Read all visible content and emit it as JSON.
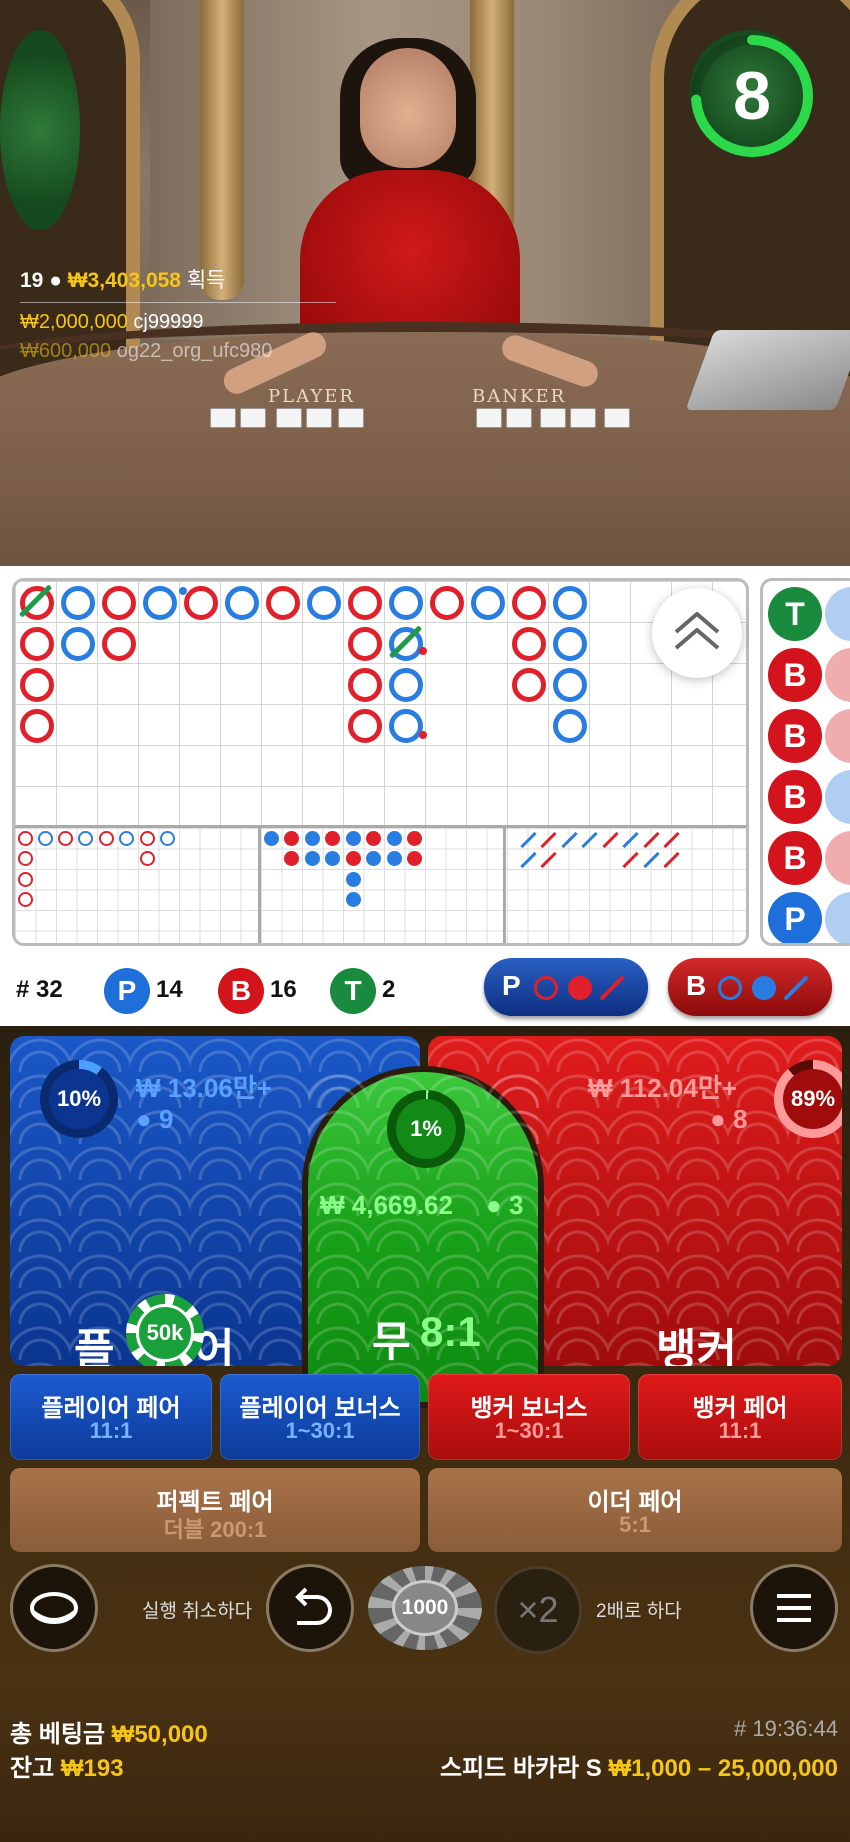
{
  "video": {
    "timer": "8",
    "table_labels": {
      "player": "PLAYER",
      "banker": "BANKER"
    },
    "winners": {
      "count": "19",
      "total": "₩3,403,058",
      "suffix": "획득",
      "rows": [
        {
          "amount": "₩2,000,000",
          "user": "cj99999"
        },
        {
          "amount": "₩600,000",
          "user": "og22_org_ufc980"
        }
      ]
    }
  },
  "stats": {
    "round_label": "# 32",
    "player": {
      "letter": "P",
      "count": "14"
    },
    "banker": {
      "letter": "B",
      "count": "16"
    },
    "tie": {
      "letter": "T",
      "count": "2"
    },
    "predict_player": "P",
    "predict_banker": "B"
  },
  "bead_road": [
    "T",
    "B",
    "B",
    "B",
    "B",
    "P"
  ],
  "bets": {
    "player": {
      "percent": "10%",
      "amount": "₩ 13.06만+",
      "players": "9",
      "label": "플레이어",
      "label_left": "플",
      "label_right": "어",
      "chip": "50k"
    },
    "tie": {
      "percent": "1%",
      "amount": "₩ 4,669.62",
      "players": "3",
      "label": "무",
      "odds": "8:1"
    },
    "banker": {
      "percent": "89%",
      "amount": "₩ 112.04만+",
      "players": "8",
      "label": "뱅커"
    }
  },
  "side_bets": [
    {
      "name": "플레이어 페어",
      "odds": "11:1"
    },
    {
      "name": "플레이어 보너스",
      "odds": "1~30:1"
    },
    {
      "name": "뱅커 보너스",
      "odds": "1~30:1"
    },
    {
      "name": "뱅커 페어",
      "odds": "11:1"
    }
  ],
  "pair_bets": [
    {
      "name": "퍼펙트 페어",
      "odds": "더블 200:1"
    },
    {
      "name": "이더 페어",
      "odds": "5:1"
    }
  ],
  "controls": {
    "undo_label": "실행 취소하다",
    "chip_value": "1000",
    "double_icon": "×2",
    "double_label": "2배로 하다"
  },
  "footer": {
    "total_bet_label": "총 베팅금",
    "total_bet": "₩50,000",
    "balance_label": "잔고",
    "balance": "₩193",
    "time": "# 19:36:44",
    "table_name": "스피드 바카라 S",
    "limits": "₩1,000 – 25,000,000"
  },
  "colors": {
    "player": "#1e6fd9",
    "banker": "#d4141c",
    "tie": "#1a8a3e",
    "gold": "#f5c518"
  }
}
